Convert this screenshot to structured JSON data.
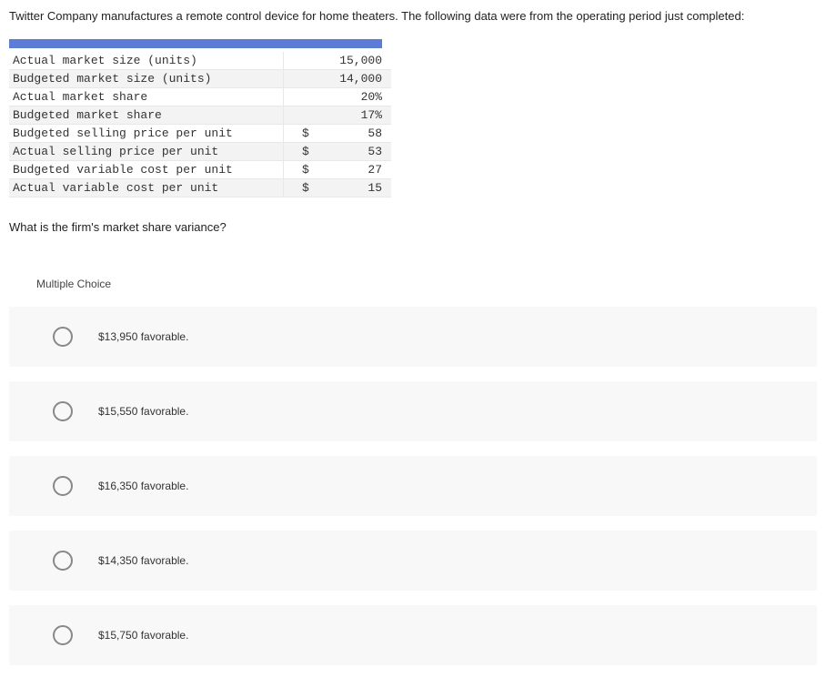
{
  "intro": "Twitter Company manufactures a remote control device for home theaters. The following data were from the operating period just completed:",
  "rows": [
    {
      "label": "Actual market size (units)",
      "cur": "",
      "val": "15,000",
      "alt": false
    },
    {
      "label": "Budgeted market size (units)",
      "cur": "",
      "val": "14,000",
      "alt": true
    },
    {
      "label": "Actual market share",
      "cur": "",
      "val": "20%",
      "alt": false
    },
    {
      "label": "Budgeted market share",
      "cur": "",
      "val": "17%",
      "alt": true
    },
    {
      "label": "Budgeted selling price per unit",
      "cur": "$",
      "val": "58",
      "alt": false
    },
    {
      "label": "Actual selling price per unit",
      "cur": "$",
      "val": "53",
      "alt": true
    },
    {
      "label": "Budgeted variable cost per unit",
      "cur": "$",
      "val": "27",
      "alt": false
    },
    {
      "label": "Actual variable cost per unit",
      "cur": "$",
      "val": "15",
      "alt": true
    }
  ],
  "question": "What is the firm's market share variance?",
  "mc_label": "Multiple Choice",
  "options": [
    "$13,950 favorable.",
    "$15,550 favorable.",
    "$16,350 favorable.",
    "$14,350 favorable.",
    "$15,750 favorable."
  ]
}
